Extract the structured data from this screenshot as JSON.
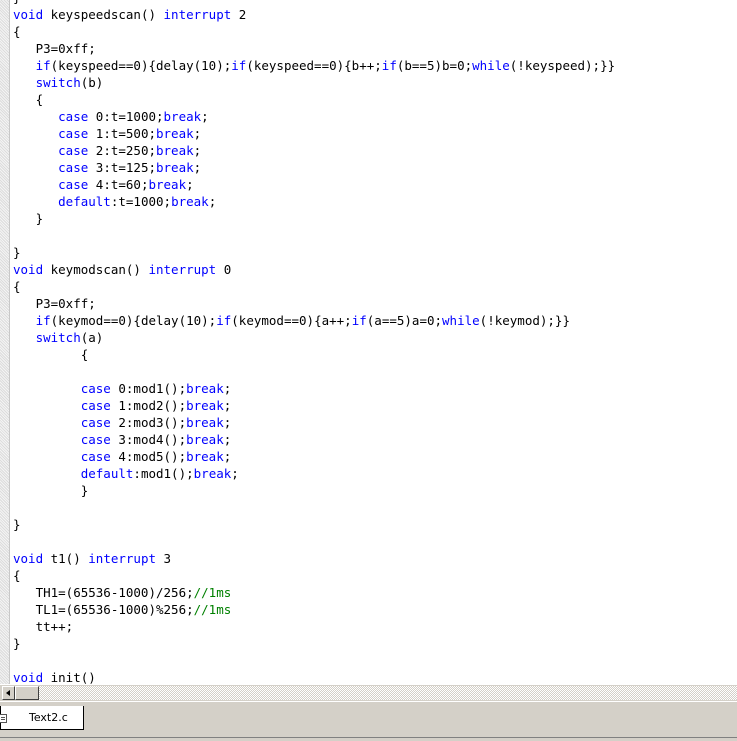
{
  "code_lines": [
    "}",
    "void keyspeedscan() interrupt 2",
    "{",
    "   P3=0xff;",
    "   if(keyspeed==0){delay(10);if(keyspeed==0){b++;if(b==5)b=0;while(!keyspeed);}}",
    "   switch(b)",
    "   {",
    "      case 0:t=1000;break;",
    "      case 1:t=500;break;",
    "      case 2:t=250;break;",
    "      case 3:t=125;break;",
    "      case 4:t=60;break;",
    "      default:t=1000;break;",
    "   }",
    "",
    "}",
    "void keymodscan() interrupt 0",
    "{",
    "   P3=0xff;",
    "   if(keymod==0){delay(10);if(keymod==0){a++;if(a==5)a=0;while(!keymod);}}",
    "   switch(a)",
    "         {",
    "",
    "         case 0:mod1();break;",
    "         case 1:mod2();break;",
    "         case 2:mod3();break;",
    "         case 3:mod4();break;",
    "         case 4:mod5();break;",
    "         default:mod1();break;",
    "         }",
    "",
    "}",
    "",
    "void t1() interrupt 3",
    "{",
    "   TH1=(65536-1000)/256;//1ms",
    "   TL1=(65536-1000)%256;//1ms",
    "   tt++;",
    "}",
    "",
    "void init()"
  ],
  "keywords": [
    "void",
    "interrupt",
    "if",
    "while",
    "switch",
    "case",
    "break",
    "default"
  ],
  "colors": {
    "keyword": "#0000ff",
    "comment": "#008000",
    "text": "#000000"
  },
  "tab": {
    "label": "Text2.c",
    "icon": "document-icon"
  },
  "scrollbar": {
    "left_arrow": "scroll-left-arrow-icon"
  }
}
